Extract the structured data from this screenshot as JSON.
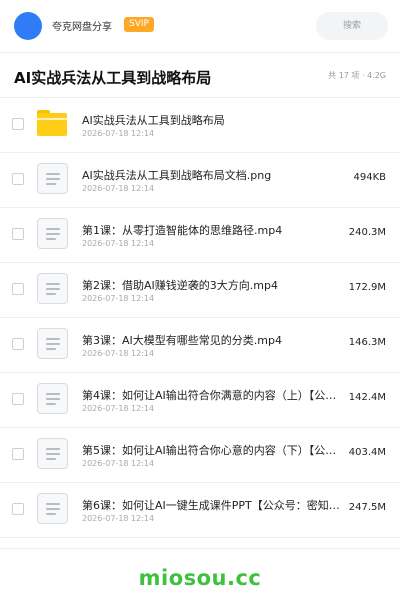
{
  "header": {
    "app_name": "夸克网盘分享",
    "badge": "SVIP",
    "search_placeholder": "搜索"
  },
  "folder": {
    "title": "AI实战兵法从工具到战略布局",
    "meta": "共 17 项 · 4.2G"
  },
  "files": [
    {
      "name": "AI实战兵法从工具到战略布局",
      "date": "2026-07-18 12:14",
      "size": "",
      "icon": "folder-icon"
    },
    {
      "name": "AI实战兵法从工具到战略布局文档.png",
      "date": "2026-07-18 12:14",
      "size": "494KB",
      "icon": "file-icon"
    },
    {
      "name": "第1课：从零打造智能体的思维路径.mp4",
      "date": "2026-07-18 12:14",
      "size": "240.3M",
      "icon": "file-icon"
    },
    {
      "name": "第2课：借助AI赚钱逆袭的3大方向.mp4",
      "date": "2026-07-18 12:14",
      "size": "172.9M",
      "icon": "file-icon"
    },
    {
      "name": "第3课：AI大模型有哪些常见的分类.mp4",
      "date": "2026-07-18 12:14",
      "size": "146.3M",
      "icon": "file-icon"
    },
    {
      "name": "第4课：如何让AI输出符合你满意的内容（上）【公众…",
      "date": "2026-07-18 12:14",
      "size": "142.4M",
      "icon": "file-icon"
    },
    {
      "name": "第5课：如何让AI输出符合你心意的内容（下）【公众…",
      "date": "2026-07-18 12:14",
      "size": "403.4M",
      "icon": "file-icon"
    },
    {
      "name": "第6课：如何让AI一键生成课件PPT【公众号：密知…",
      "date": "2026-07-18 12:14",
      "size": "247.5M",
      "icon": "file-icon"
    }
  ],
  "watermark": "miosou.cc",
  "colors": {
    "avatar": "#2f7cf6",
    "svip": "#ffa726",
    "folder": "#ffcc17",
    "watermark": "#3ec23e"
  }
}
